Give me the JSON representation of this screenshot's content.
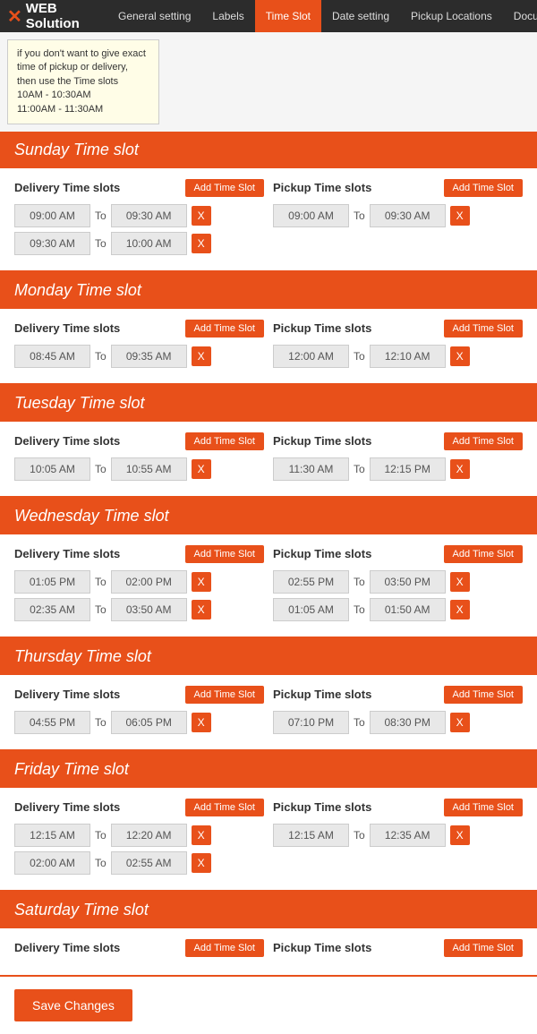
{
  "nav": {
    "logo": "WEB Solution",
    "tabs": [
      {
        "label": "General setting",
        "active": false
      },
      {
        "label": "Labels",
        "active": false
      },
      {
        "label": "Time Slot",
        "active": true
      },
      {
        "label": "Date setting",
        "active": false
      },
      {
        "label": "Pickup Locations",
        "active": false
      }
    ],
    "doc": "Documentation"
  },
  "tooltip": {
    "text": "if you don't want to give exact time of pickup or delivery, then use the Time slots\n10AM - 10:30AM\n11:00AM - 11:30AM"
  },
  "days": [
    {
      "name": "Sunday Time slot",
      "delivery": {
        "label": "Delivery Time slots",
        "btn": "Add Time Slot",
        "slots": [
          {
            "from": "09:00 AM",
            "to": "09:30 AM"
          },
          {
            "from": "09:30 AM",
            "to": "10:00 AM"
          }
        ]
      },
      "pickup": {
        "label": "Pickup Time slots",
        "btn": "Add Time Slot",
        "slots": [
          {
            "from": "09:00 AM",
            "to": "09:30 AM"
          }
        ]
      }
    },
    {
      "name": "Monday Time slot",
      "delivery": {
        "label": "Delivery Time slots",
        "btn": "Add Time Slot",
        "slots": [
          {
            "from": "08:45 AM",
            "to": "09:35 AM"
          }
        ]
      },
      "pickup": {
        "label": "Pickup Time slots",
        "btn": "Add Time Slot",
        "slots": [
          {
            "from": "12:00 AM",
            "to": "12:10 AM"
          }
        ]
      }
    },
    {
      "name": "Tuesday Time slot",
      "delivery": {
        "label": "Delivery Time slots",
        "btn": "Add Time Slot",
        "slots": [
          {
            "from": "10:05 AM",
            "to": "10:55 AM"
          }
        ]
      },
      "pickup": {
        "label": "Pickup Time slots",
        "btn": "Add Time Slot",
        "slots": [
          {
            "from": "11:30 AM",
            "to": "12:15 PM"
          }
        ]
      }
    },
    {
      "name": "Wednesday Time slot",
      "delivery": {
        "label": "Delivery Time slots",
        "btn": "Add Time Slot",
        "slots": [
          {
            "from": "01:05 PM",
            "to": "02:00 PM"
          },
          {
            "from": "02:35 AM",
            "to": "03:50 AM"
          }
        ]
      },
      "pickup": {
        "label": "Pickup Time slots",
        "btn": "Add Time Slot",
        "slots": [
          {
            "from": "02:55 PM",
            "to": "03:50 PM"
          },
          {
            "from": "01:05 AM",
            "to": "01:50 AM"
          }
        ]
      }
    },
    {
      "name": "Thursday Time slot",
      "delivery": {
        "label": "Delivery Time slots",
        "btn": "Add Time Slot",
        "slots": [
          {
            "from": "04:55 PM",
            "to": "06:05 PM"
          }
        ]
      },
      "pickup": {
        "label": "Pickup Time slots",
        "btn": "Add Time Slot",
        "slots": [
          {
            "from": "07:10 PM",
            "to": "08:30 PM"
          }
        ]
      }
    },
    {
      "name": "Friday Time slot",
      "delivery": {
        "label": "Delivery Time slots",
        "btn": "Add Time Slot",
        "slots": [
          {
            "from": "12:15 AM",
            "to": "12:20 AM"
          },
          {
            "from": "02:00 AM",
            "to": "02:55 AM"
          }
        ]
      },
      "pickup": {
        "label": "Pickup Time slots",
        "btn": "Add Time Slot",
        "slots": [
          {
            "from": "12:15 AM",
            "to": "12:35 AM"
          }
        ]
      }
    },
    {
      "name": "Saturday Time slot",
      "delivery": {
        "label": "Delivery Time slots",
        "btn": "Add Time Slot",
        "slots": []
      },
      "pickup": {
        "label": "Pickup Time slots",
        "btn": "Add Time Slot",
        "slots": []
      }
    }
  ],
  "save_button": "Save Changes"
}
